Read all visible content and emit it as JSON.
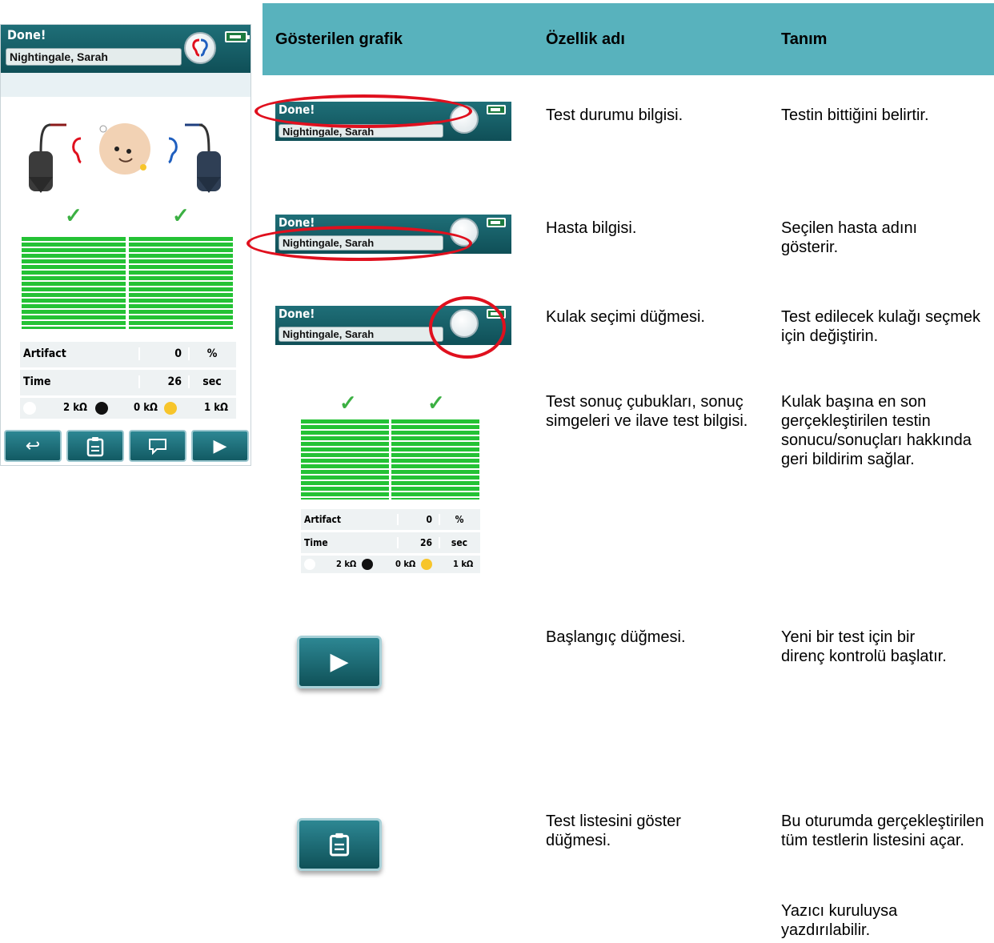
{
  "device": {
    "status": "Done!",
    "patient": "Nightingale, Sarah",
    "artifact_label": "Artifact",
    "artifact_value": "0",
    "artifact_unit": "%",
    "time_label": "Time",
    "time_value": "26",
    "time_unit": "sec",
    "impedance_white": "2 kΩ",
    "impedance_black": "0 kΩ",
    "impedance_yellow": "1 kΩ",
    "colors": {
      "header": "#0f4f57",
      "bars": "#24c235",
      "check": "#3cb043",
      "right_ear": "#e0101e",
      "left_ear": "#1f5fbf"
    }
  },
  "table": {
    "headers": {
      "graphic": "Gösterilen grafik",
      "feature": "Özellik adı",
      "description": "Tanım"
    },
    "rows": [
      {
        "feature": "Test durumu bilgisi.",
        "description": "Testin bittiğini belirtir."
      },
      {
        "feature": "Hasta bilgisi.",
        "description": "Seçilen hasta adını gösterir."
      },
      {
        "feature": "Kulak seçimi düğmesi.",
        "description": "Test edilecek kulağı seçmek için değiştirin."
      },
      {
        "feature": "Test sonuç çubukları, sonuç simgeleri ve ilave test bilgisi.",
        "description": "Kulak başına en son gerçekleştirilen testin sonucu/sonuçları hakkında geri bildirim sağlar."
      },
      {
        "feature": "Başlangıç düğmesi.",
        "description": "Yeni bir test için bir direnç kontrolü başlatır."
      },
      {
        "feature": "Test listesini göster düğmesi.",
        "description": "Bu oturumda gerçekleştirilen tüm testlerin listesini açar.",
        "note": "Yazıcı kuruluysa yazdırılabilir."
      }
    ],
    "header_color": "#58b2bd",
    "highlight_color": "#e0101e"
  },
  "snapshots": {
    "status_1": "Done!",
    "patient_1": "Nightingale, Sarah",
    "status_2": "Done!",
    "patient_2": "Nightingale, Sarah",
    "status_3": "Done!",
    "patient_3": "Nightingale, Sarah"
  }
}
